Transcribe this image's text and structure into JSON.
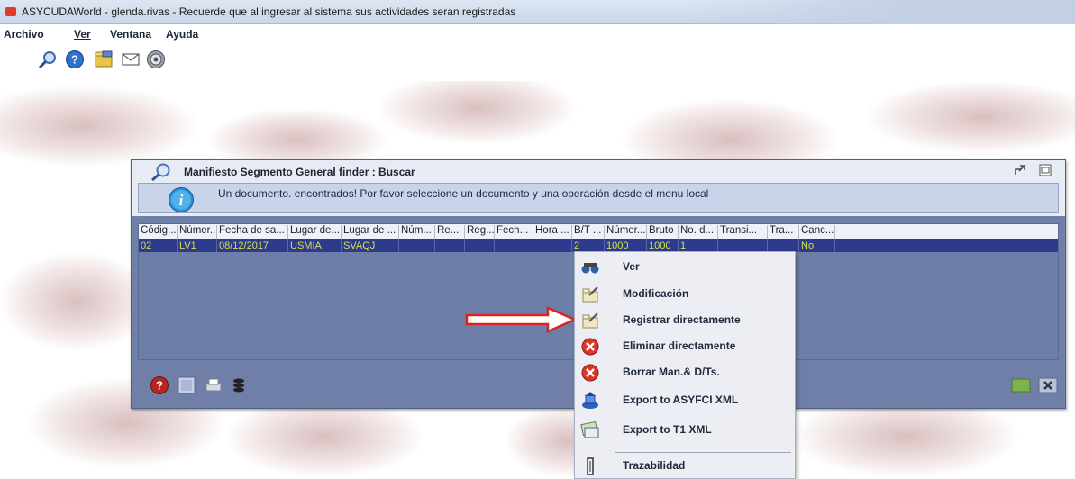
{
  "window": {
    "title": "ASYCUDAWorld - glenda.rivas - Recuerde que al ingresar al sistema sus actividades seran registradas"
  },
  "menu": [
    "Archivo",
    "Ver",
    "Ventana",
    "Ayuda"
  ],
  "toolbar": {
    "icons": [
      "search-icon",
      "help-icon",
      "folder-icon",
      "mail-icon",
      "power-icon"
    ]
  },
  "finder": {
    "title": "Manifiesto Segmento General finder : Buscar",
    "message": "Un documento. encontrados! Por favor seleccione un documento y una operación desde el menu local",
    "columns": [
      "Códig...",
      "Númer...",
      "Fecha de sa...",
      "Lugar de...",
      "Lugar de ...",
      "Núm...",
      "Re...",
      "Reg...",
      "Fech...",
      "Hora ...",
      "B/T ...",
      "Númer...",
      "Bruto",
      "No. d...",
      "Transi...",
      "Tra...",
      "Canc..."
    ],
    "row": [
      "02",
      "LV1",
      "08/12/2017",
      "USMIA",
      "SVAQJ",
      "",
      "",
      "",
      "",
      "",
      "2",
      "1000",
      "1000",
      "1",
      "",
      "",
      "No"
    ]
  },
  "context_menu": {
    "items": [
      {
        "label": "Ver",
        "icon": "view-icon"
      },
      {
        "label": "Modificación",
        "icon": "edit-folder-icon"
      },
      {
        "label": "Registrar directamente",
        "icon": "register-folder-icon"
      },
      {
        "label": "Eliminar directamente",
        "icon": "delete-icon"
      },
      {
        "label": "Borrar Man.& D/Ts.",
        "icon": "delete-icon"
      },
      {
        "label": "Export to ASYFCI XML",
        "icon": "export-xml-icon"
      },
      {
        "label": "Export to T1 XML",
        "icon": "export-t1-icon"
      },
      {
        "label": "Trazabilidad",
        "icon": "trace-icon"
      }
    ]
  },
  "colors": {
    "selected_row": "#2e3a8c",
    "selected_text": "#d7e247",
    "window_body": "#6f7fa8",
    "annotation_arrow": "#e02020"
  }
}
